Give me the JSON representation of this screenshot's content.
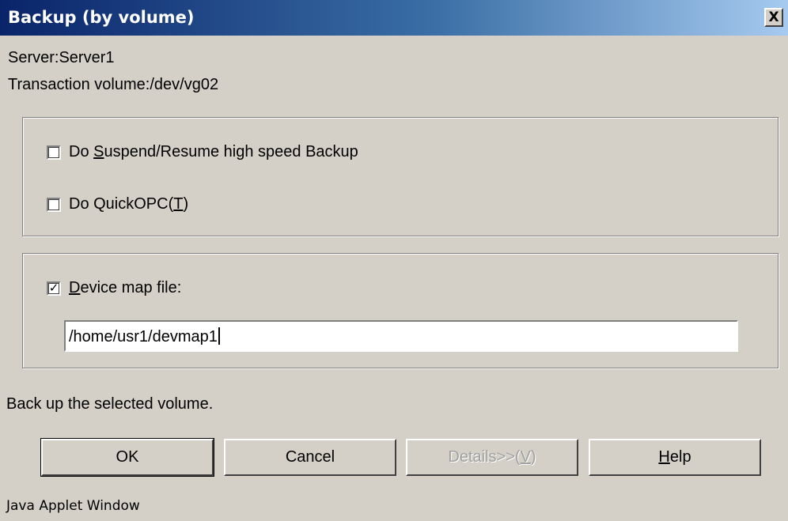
{
  "window": {
    "title": "Backup (by volume)",
    "close_label": "X"
  },
  "info": {
    "server": "Server:Server1",
    "transaction_volume": "Transaction volume:/dev/vg02"
  },
  "options": {
    "suspend_resume": {
      "prefix": "Do ",
      "mnemonic": "S",
      "suffix": "uspend/Resume high speed Backup",
      "checked": false
    },
    "quick_opc": {
      "prefix": "Do QuickOPC(",
      "mnemonic": "T",
      "suffix": ")",
      "checked": false
    }
  },
  "device_map": {
    "mnemonic": "D",
    "suffix": "evice map file:",
    "checked": true,
    "check_mark": "✓",
    "value": "/home/usr1/devmap1"
  },
  "status_text": "Back up the selected volume.",
  "buttons": {
    "ok": "OK",
    "cancel": "Cancel",
    "details": {
      "prefix": "Details>>(",
      "mnemonic": "V",
      "suffix": ")"
    },
    "help": {
      "mnemonic": "H",
      "suffix": "elp"
    }
  },
  "footer": "Java Applet Window"
}
